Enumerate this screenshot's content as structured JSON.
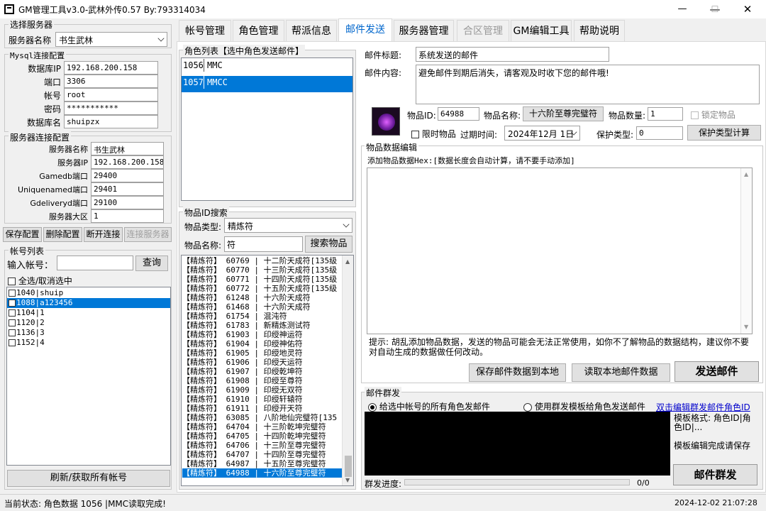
{
  "window": {
    "title": "GM管理工具v3.0-武林外传0.57 By:793314034",
    "min": "—",
    "max": "☐",
    "close": "✕"
  },
  "left": {
    "server_select": {
      "group": "选择服务器",
      "name_label": "服务器名称",
      "name_value": "书生武林"
    },
    "mysql": {
      "group": "Mysql连接配置",
      "fields": [
        {
          "label": "数据库IP",
          "value": "192.168.200.158"
        },
        {
          "label": "端口",
          "value": "3306"
        },
        {
          "label": "帐号",
          "value": "root"
        },
        {
          "label": "密码",
          "value": "***********"
        },
        {
          "label": "数据库名",
          "value": "shuipzx"
        }
      ]
    },
    "server_conn": {
      "group": "服务器连接配置",
      "fields": [
        {
          "label": "服务器名称",
          "value": "书生武林"
        },
        {
          "label": "服务器IP",
          "value": "192.168.200.158"
        },
        {
          "label": "Gamedb端口",
          "value": "29400"
        },
        {
          "label": "Uniquenamed端口",
          "value": "29401"
        },
        {
          "label": "Gdeliveryd端口",
          "value": "29100"
        },
        {
          "label": "服务器大区",
          "value": "1"
        }
      ]
    },
    "buttons": [
      "保存配置",
      "删除配置",
      "断开连接",
      "连接服务器"
    ],
    "accounts": {
      "group": "帐号列表",
      "input_label": "输入帐号：",
      "input_value": "",
      "query": "查询",
      "select_all": "全选/取消选中",
      "items": [
        "1040|shuip",
        "1088|a123456",
        "1104|1",
        "1120|2",
        "1136|3",
        "1152|4"
      ],
      "refresh": "刷新/获取所有帐号"
    }
  },
  "tabs": [
    "帐号管理",
    "角色管理",
    "帮派信息",
    "邮件发送",
    "服务器管理",
    "合区管理",
    "GM编辑工具",
    "帮助说明"
  ],
  "roles": {
    "group": "角色列表【选中角色发送邮件】",
    "items": [
      {
        "id": "1056",
        "name": "MMC"
      },
      {
        "id": "1057",
        "name": "MMCC"
      }
    ]
  },
  "item_search": {
    "group": "物品ID搜索",
    "type_label": "物品类型:",
    "type_value": "精炼符",
    "name_label": "物品名称:",
    "name_value": "符",
    "search": "搜索物品",
    "results": [
      "【精炼符】 60769 | 十二阶天成符[135级",
      "【精炼符】 60770 | 十三阶天成符[135级",
      "【精炼符】 60771 | 十四阶天成符[135级",
      "【精炼符】 60772 | 十五阶天成符[135级",
      "【精炼符】 61248 | 十六阶天成符",
      "【精炼符】 61468 | 十六阶天成符",
      "【精炼符】 61754 | 混沌符",
      "【精炼符】 61783 | 新精炼测试符",
      "【精炼符】 61903 | 印绶神运符",
      "【精炼符】 61904 | 印绶神佑符",
      "【精炼符】 61905 | 印绶地灵符",
      "【精炼符】 61906 | 印绶天运符",
      "【精炼符】 61907 | 印绶乾坤符",
      "【精炼符】 61908 | 印绶至尊符",
      "【精炼符】 61909 | 印绶无双符",
      "【精炼符】 61910 | 印绶轩辕符",
      "【精炼符】 61911 | 印绶开天符",
      "【精炼符】 63085 | 八阶地仙完璧符[135",
      "【精炼符】 64704 | 十三阶乾坤完璧符",
      "【精炼符】 64705 | 十四阶乾坤完璧符",
      "【精炼符】 64706 | 十三阶至尊完璧符",
      "【精炼符】 64707 | 十四阶至尊完璧符",
      "【精炼符】 64987 | 十五阶至尊完璧符",
      "【精炼符】 64988 | 十六阶至尊完璧符"
    ]
  },
  "mail": {
    "title_label": "邮件标题:",
    "title_value": "系统发送的邮件",
    "content_label": "邮件内容:",
    "content_value": "避免邮件到期后消失，请客观及时收下您的邮件哦!",
    "item_id_label": "物品ID:",
    "item_id_value": "64988",
    "item_name_label": "物品名称:",
    "item_name_value": "十六阶至尊完璧符",
    "qty_label": "物品数量:",
    "qty_value": "1",
    "lock_label": "锁定物品",
    "limited_label": "限时物品",
    "expire_label": "过期时间:",
    "expire_value": "2024年12月 1日",
    "protect_label": "保护类型:",
    "protect_value": "0",
    "protect_btn": "保护类型计算",
    "data_group": "物品数据编辑",
    "hex_hint": "添加物品数据Hex:[数据长度会自动计算，请不要手动添加]",
    "warning": "提示: 胡乱添加物品数据，发送的物品可能会无法正常使用，如你不了解物品的数据结构，建议你不要对自动生成的数据做任何改动。",
    "save_btn": "保存邮件数据到本地",
    "read_btn": "读取本地邮件数据",
    "send_btn": "发送邮件"
  },
  "group_send": {
    "group": "邮件群发",
    "opt1": "给选中帐号的所有角色发邮件",
    "opt2": "使用群发模板给角色发送邮件",
    "link": "双击编辑群发邮件角色ID",
    "tpl_info": "模板格式: 角色ID|角色ID|...",
    "tpl_save": "模板编辑完成请保存",
    "send_btn": "邮件群发",
    "progress_label": "群发进度:",
    "progress_text": "0/0",
    "progress": 0
  },
  "status": {
    "text": "当前状态:  角色数据 1056 |MMC读取完成!",
    "time": "2024-12-02 21:07:28"
  },
  "colors": {
    "accent": "#0078d7",
    "tab_sel": "#0066cc",
    "link": "#0000cc"
  }
}
